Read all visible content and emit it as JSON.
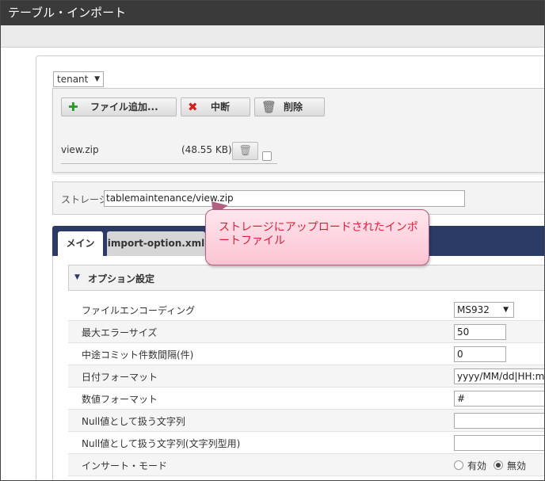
{
  "window": {
    "title": "テーブル・インポート"
  },
  "tenant": {
    "selected": "tenant"
  },
  "upload": {
    "add_label": "ファイル追加...",
    "stop_label": "中断",
    "delete_label": "削除",
    "file": {
      "name": "view.zip",
      "size": "(48.55 KB)"
    }
  },
  "storage": {
    "label": "ストレージ",
    "value": "tablemaintenance/view.zip"
  },
  "tabs": [
    {
      "label": "メイン",
      "active": true
    },
    {
      "label": "import-option.xml",
      "active": false
    }
  ],
  "callout": {
    "text": "ストレージにアップロードされたインポートファイル"
  },
  "options": {
    "section_title": "オプション設定",
    "rows": [
      {
        "label": "ファイルエンコーディング",
        "value": "MS932"
      },
      {
        "label": "最大エラーサイズ",
        "value": "50"
      },
      {
        "label": "中途コミット件数間隔(件)",
        "value": "0"
      },
      {
        "label": "日付フォーマット",
        "value": "yyyy/MM/dd|HH:mm:ss"
      },
      {
        "label": "数値フォーマット",
        "value": "#"
      },
      {
        "label": "Null値として扱う文字列",
        "value": ""
      },
      {
        "label": "Null値として扱う文字列(文字列型用)",
        "value": ""
      },
      {
        "label": "インサート・モード",
        "radio_on": "有効",
        "radio_off": "無効",
        "selected": "無効"
      }
    ]
  },
  "colors": {
    "titlebar": "#3a3a3a",
    "tabbar": "#2c3a66",
    "callout_text": "#e0203a"
  },
  "icons": {
    "add": "plus-icon",
    "stop": "x-icon",
    "delete": "trash-icon"
  }
}
